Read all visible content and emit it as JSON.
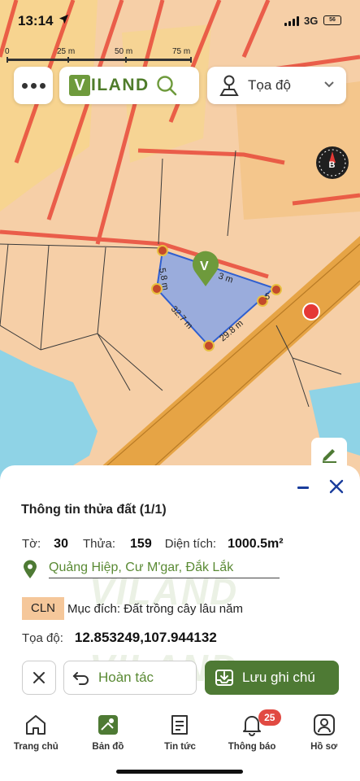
{
  "status_bar": {
    "time": "13:14",
    "network": "3G",
    "battery": "56"
  },
  "scale": {
    "labels": [
      "0",
      "25 m",
      "50 m",
      "75 m"
    ]
  },
  "top_bar": {
    "logo_text": "ILAND",
    "logo_letter": "V",
    "coord_select_value": "Tọa độ"
  },
  "map": {
    "parcel_edge_labels": [
      "5.8 m",
      "3 m",
      "32.7 m",
      "29.8 m",
      "5"
    ],
    "parcel_color": "#9aacdc",
    "road_color": "#e6a445",
    "land_color": "#f6cfa7",
    "water_color": "#8fd3e6",
    "boundary_color": "#e84a3a",
    "marker_color": "#6e9a3c"
  },
  "panel": {
    "title": "Thông tin thửa đất (1/1)",
    "sheet_label": "Tờ:",
    "sheet_value": "30",
    "parcel_label": "Thửa:",
    "parcel_value": "159",
    "area_label": "Diện tích:",
    "area_value": "1000.5m²",
    "address": "Quảng Hiệp, Cư M'gar, Đắk Lắk",
    "land_code": "CLN",
    "purpose": "Mục đích: Đất trồng cây lâu năm",
    "coord_label": "Tọa độ:",
    "coord_value": "12.853249,107.944132",
    "watermark": "VILAND",
    "undo_label": "Hoàn tác",
    "save_label": "Lưu ghi chú",
    "accent": "#4e7a34"
  },
  "bottom_nav": {
    "items": [
      {
        "label": "Trang chủ",
        "icon": "home-icon"
      },
      {
        "label": "Bản đồ",
        "icon": "map-icon"
      },
      {
        "label": "Tin tức",
        "icon": "news-icon"
      },
      {
        "label": "Thông báo",
        "icon": "bell-icon",
        "badge": "25"
      },
      {
        "label": "Hồ sơ",
        "icon": "profile-icon"
      }
    ]
  }
}
